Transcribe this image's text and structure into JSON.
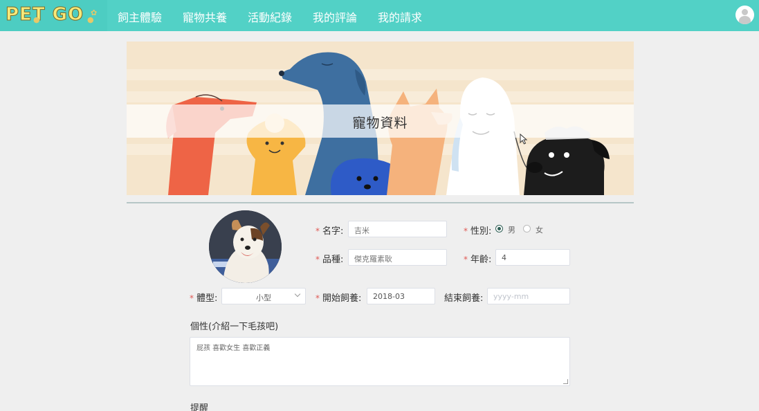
{
  "nav": {
    "logo": "PET GO",
    "items": [
      "飼主體驗",
      "寵物共養",
      "活動紀錄",
      "我的評論",
      "我的請求"
    ]
  },
  "banner": {
    "title": "寵物資料"
  },
  "form": {
    "required_mark": "*",
    "name": {
      "label": "名字:",
      "value": "吉米"
    },
    "gender": {
      "label": "性別:",
      "options": [
        "男",
        "女"
      ],
      "selected": "男"
    },
    "breed": {
      "label": "品種:",
      "value": "傑克羅素耿"
    },
    "age": {
      "label": "年齡:",
      "value": "4"
    },
    "size": {
      "label": "體型:",
      "value": "小型"
    },
    "start_date": {
      "label": "開始飼養:",
      "value": "2018-03"
    },
    "end_date": {
      "label": "結束飼養:",
      "placeholder": "yyyy-mm"
    },
    "personality": {
      "label": "個性(介紹一下毛孩吧)",
      "value": "屁孩 喜歡女生 喜歡正義"
    },
    "reminder": {
      "label": "提醒"
    }
  },
  "colors": {
    "navbar": "#52d1c6",
    "page_background": "#efefef",
    "banner_background": "#f5e5cc",
    "required": "#e05a55"
  }
}
